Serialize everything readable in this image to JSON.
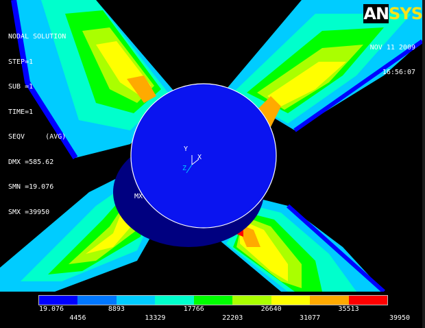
{
  "logo": {
    "part1": "AN",
    "part2": "SYS"
  },
  "info": {
    "lines": [
      "NODAL SOLUTION",
      "STEP=1",
      "SUB =1",
      "TIME=1",
      "SEQV     (AVG)",
      "DMX =585.62",
      "SMN =19.076",
      "SMX =39950"
    ]
  },
  "datetime": {
    "date": "NOV 11 2009",
    "time": "16:56:07"
  },
  "axes": {
    "y": "Y",
    "x": "X",
    "z": "Z"
  },
  "labels": {
    "max": "MX"
  },
  "legend": {
    "colors": [
      "#0000ff",
      "#0077ff",
      "#00ccff",
      "#00ffcc",
      "#00ff00",
      "#aaff00",
      "#ffff00",
      "#ffaa00",
      "#ff0000"
    ],
    "top_values": [
      "19.076",
      "8893",
      "17766",
      "26640",
      "35513"
    ],
    "bottom_values": [
      "4456",
      "13329",
      "22203",
      "31077",
      "39950"
    ]
  }
}
